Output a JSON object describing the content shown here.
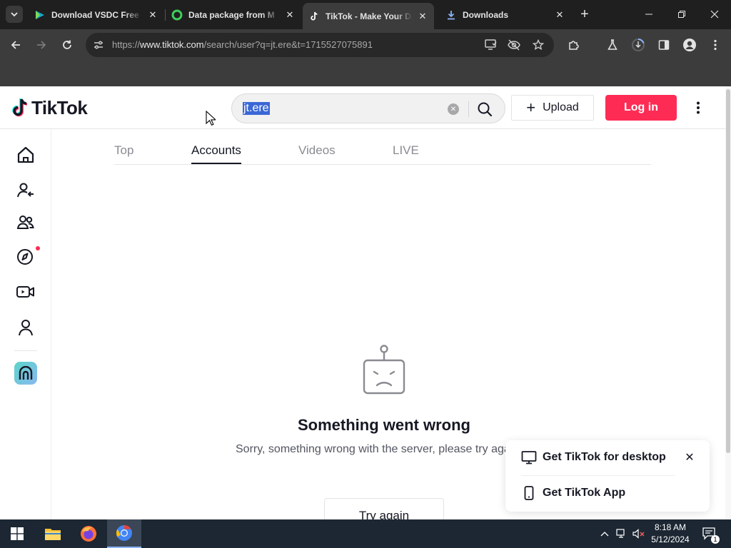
{
  "browser": {
    "tabs": [
      {
        "title": "Download VSDC Free",
        "favicon": "vsdc-icon",
        "active": false
      },
      {
        "title": "Data package from M",
        "favicon": "green-ring-icon",
        "active": false
      },
      {
        "title": "TikTok - Make Your Da",
        "favicon": "tiktok-icon",
        "active": true
      },
      {
        "title": "Downloads",
        "favicon": "download-icon",
        "active": false
      }
    ],
    "url_prefix": "https://",
    "url_host": "www.tiktok.com",
    "url_path": "/search/user?q=jt.ere&t=1715527075891"
  },
  "tiktok": {
    "logo_text": "TikTok",
    "search_query": "jt.ere",
    "upload_label": "Upload",
    "login_label": "Log in",
    "tabs": [
      {
        "label": "Top",
        "active": false
      },
      {
        "label": "Accounts",
        "active": true
      },
      {
        "label": "Videos",
        "active": false
      },
      {
        "label": "LIVE",
        "active": false
      }
    ],
    "error_title": "Something went wrong",
    "error_desc": "Sorry, something wrong with the server, please try again.",
    "try_again_label": "Try again",
    "promo": {
      "desktop_label": "Get TikTok for desktop",
      "app_label": "Get TikTok App"
    },
    "colors": {
      "brand": "#fe2c55",
      "text": "#161823"
    }
  },
  "taskbar": {
    "time": "8:18 AM",
    "date": "5/12/2024",
    "notifications": "1"
  }
}
